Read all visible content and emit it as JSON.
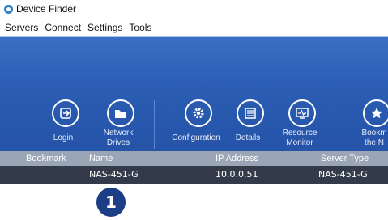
{
  "window": {
    "title": "Device Finder"
  },
  "menu": [
    "Servers",
    "Connect",
    "Settings",
    "Tools"
  ],
  "toolbar": {
    "login": "Login",
    "network_drives_1": "Network",
    "network_drives_2": "Drives",
    "configuration": "Configuration",
    "details": "Details",
    "resource_monitor_1": "Resource",
    "resource_monitor_2": "Monitor",
    "bookmark_1": "Bookm",
    "bookmark_2": "the N"
  },
  "table": {
    "columns": [
      "Bookmark",
      "Name",
      "IP Address",
      "Server Type"
    ],
    "rows": [
      {
        "bookmark": "",
        "name": "NAS-451-G",
        "ip": "10.0.0.51",
        "server_type": "NAS-451-G"
      }
    ]
  },
  "callout": {
    "number": "1"
  },
  "colors": {
    "toolbar": "#2a5db3",
    "header": "#9aa5b5",
    "selected_row": "#333b4a",
    "callout": "#1b3e86"
  }
}
